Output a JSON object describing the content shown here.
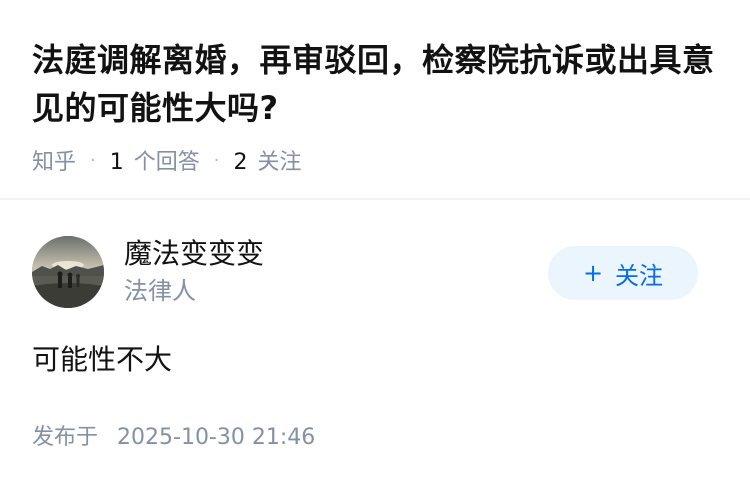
{
  "question": {
    "title": "法庭调解离婚，再审驳回，检察院抗诉或出具意见的可能性大吗?",
    "source": "知乎",
    "answer_count": "1",
    "answer_label": "个回答",
    "follower_count": "2",
    "follower_label": "关注"
  },
  "answer": {
    "author": {
      "name": "魔法变变变",
      "badge": "法律人",
      "avatar_icon": "avatar-photo-icon"
    },
    "follow_button": {
      "plus": "+",
      "label": "关注"
    },
    "content": "可能性不大",
    "publish_label": "发布于",
    "publish_time": "2025-10-30 21:46"
  },
  "colors": {
    "text_primary": "#121212",
    "text_secondary": "#8590a6",
    "brand_blue": "#056de8",
    "follow_bg": "#ebf5fd",
    "divider": "#f2f3f5"
  }
}
